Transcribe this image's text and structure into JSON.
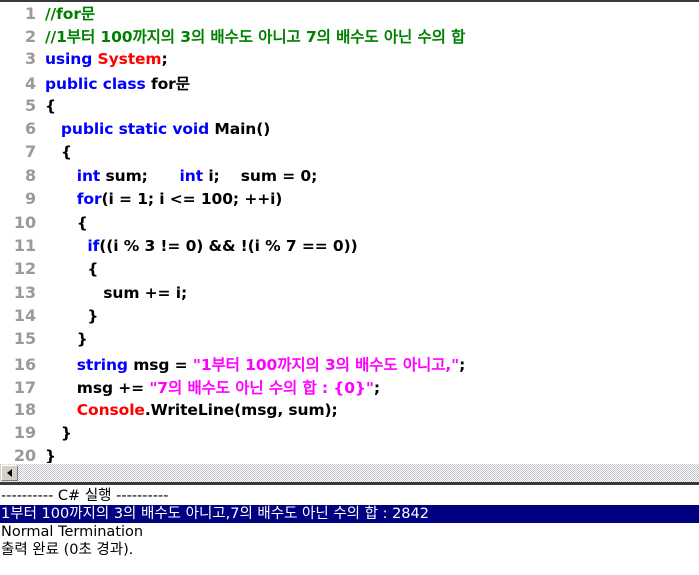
{
  "editor": {
    "lines": [
      {
        "n": "1",
        "segments": [
          {
            "t": "//for문",
            "c": "cmt"
          }
        ]
      },
      {
        "n": "2",
        "segments": [
          {
            "t": "//1부터 100까지의 3의 배수도 아니고 7의 배수도 아닌 수의 합",
            "c": "cmt"
          }
        ]
      },
      {
        "n": "3",
        "segments": [
          {
            "t": "using ",
            "c": "kw"
          },
          {
            "t": "System",
            "c": "type"
          },
          {
            "t": ";",
            "c": "id"
          }
        ]
      },
      {
        "n": "4",
        "segments": [
          {
            "t": "public class ",
            "c": "kw"
          },
          {
            "t": "for문",
            "c": "id"
          }
        ]
      },
      {
        "n": "5",
        "segments": [
          {
            "t": "{",
            "c": "id"
          }
        ]
      },
      {
        "n": "6",
        "segments": [
          {
            "t": "   ",
            "c": "id"
          },
          {
            "t": "public static void ",
            "c": "kw"
          },
          {
            "t": "Main()",
            "c": "id"
          }
        ]
      },
      {
        "n": "7",
        "segments": [
          {
            "t": "   {",
            "c": "id"
          }
        ]
      },
      {
        "n": "8",
        "segments": [
          {
            "t": "      ",
            "c": "id"
          },
          {
            "t": "int ",
            "c": "kw"
          },
          {
            "t": "sum;      ",
            "c": "id"
          },
          {
            "t": "int ",
            "c": "kw"
          },
          {
            "t": "i;    sum = 0;",
            "c": "id"
          }
        ]
      },
      {
        "n": "9",
        "segments": [
          {
            "t": "      ",
            "c": "id"
          },
          {
            "t": "for",
            "c": "kw"
          },
          {
            "t": "(i = 1; i <= 100; ++i)",
            "c": "id"
          }
        ]
      },
      {
        "n": "10",
        "segments": [
          {
            "t": "      {",
            "c": "id"
          }
        ]
      },
      {
        "n": "11",
        "segments": [
          {
            "t": "        ",
            "c": "id"
          },
          {
            "t": "if",
            "c": "kw"
          },
          {
            "t": "((i % 3 != 0) && !(i % 7 == 0))",
            "c": "id"
          }
        ]
      },
      {
        "n": "12",
        "segments": [
          {
            "t": "        {",
            "c": "id"
          }
        ]
      },
      {
        "n": "13",
        "segments": [
          {
            "t": "           sum += i;",
            "c": "id"
          }
        ]
      },
      {
        "n": "14",
        "segments": [
          {
            "t": "        }",
            "c": "id"
          }
        ]
      },
      {
        "n": "15",
        "segments": [
          {
            "t": "      }",
            "c": "id"
          }
        ]
      },
      {
        "n": "16",
        "segments": [
          {
            "t": "      ",
            "c": "id"
          },
          {
            "t": "string ",
            "c": "kw"
          },
          {
            "t": "msg = ",
            "c": "id"
          },
          {
            "t": "\"1부터 100까지의 3의 배수도 아니고,\"",
            "c": "str"
          },
          {
            "t": ";",
            "c": "id"
          }
        ]
      },
      {
        "n": "17",
        "segments": [
          {
            "t": "      msg += ",
            "c": "id"
          },
          {
            "t": "\"7의 배수도 아닌 수의 합 : {0}\"",
            "c": "str"
          },
          {
            "t": ";",
            "c": "id"
          }
        ]
      },
      {
        "n": "18",
        "segments": [
          {
            "t": "      ",
            "c": "id"
          },
          {
            "t": "Console",
            "c": "type"
          },
          {
            "t": ".WriteLine(msg, sum);",
            "c": "id"
          }
        ]
      },
      {
        "n": "19",
        "segments": [
          {
            "t": "   }",
            "c": "id"
          }
        ]
      },
      {
        "n": "20",
        "segments": [
          {
            "t": "}",
            "c": "id"
          }
        ]
      }
    ]
  },
  "scrollbar": {
    "left_arrow_icon": "arrow-left-icon"
  },
  "console": {
    "lines": [
      {
        "text": "---------- C# 실행 ----------",
        "selected": false
      },
      {
        "text": "1부터 100까지의 3의 배수도 아니고,7의 배수도 아닌 수의 합 : 2842",
        "selected": true
      },
      {
        "text": "Normal Termination",
        "selected": false
      },
      {
        "text": "출력 완료 (0초 경과).",
        "selected": false
      }
    ]
  },
  "colors": {
    "keyword": "#0000ff",
    "type": "#ff0000",
    "comment": "#008000",
    "string": "#ff00ff",
    "linenumber": "#9a9a9a",
    "selection_bg": "#000080",
    "selection_fg": "#ffffff"
  }
}
